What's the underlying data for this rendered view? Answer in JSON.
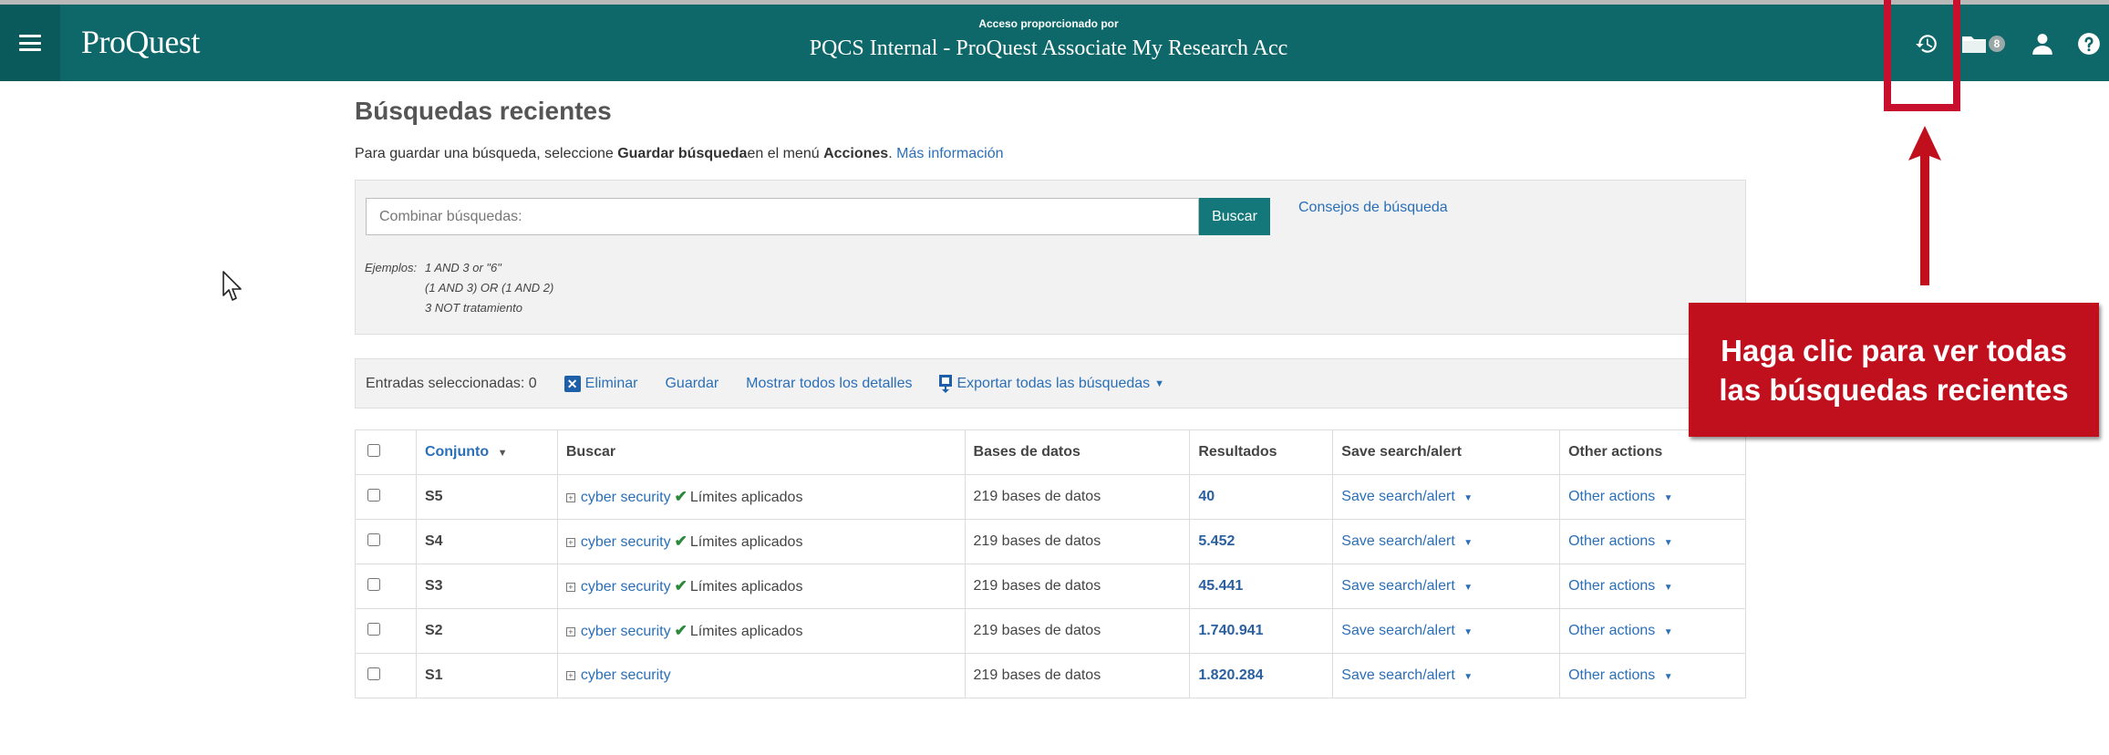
{
  "header": {
    "logo": "ProQuest",
    "access_label": "Acceso proporcionado por",
    "institution": "PQCS Internal - ProQuest Associate My Research Acc",
    "folder_count": "8"
  },
  "page": {
    "title": "Búsquedas recientes",
    "hint_prefix": "Para guardar una búsqueda, seleccione ",
    "hint_bold1": "Guardar búsqueda",
    "hint_middle": "en el menú ",
    "hint_bold2": "Acciones",
    "hint_dot": ".",
    "hint_link": "Más información"
  },
  "search": {
    "placeholder": "Combinar búsquedas:",
    "button": "Buscar",
    "tips_link": "Consejos de búsqueda",
    "examples_label": "Ejemplos:",
    "examples": [
      "1 AND 3 or \"6\"",
      "(1 AND 3) OR (1 AND 2)",
      "3 NOT tratamiento"
    ]
  },
  "actions": {
    "selected": "Entradas seleccionadas: 0",
    "delete": "Eliminar",
    "save": "Guardar",
    "show_details": "Mostrar todos los detalles",
    "export": "Exportar todas las búsquedas"
  },
  "table": {
    "headers": {
      "set": "Conjunto",
      "search": "Buscar",
      "databases": "Bases de datos",
      "results": "Resultados",
      "save": "Save search/alert",
      "other": "Other actions"
    },
    "rows": [
      {
        "set": "S5",
        "query": "cyber security",
        "limits": "Límites aplicados",
        "databases": "219 bases de datos",
        "results": "40",
        "save": "Save search/alert",
        "other": "Other actions"
      },
      {
        "set": "S4",
        "query": "cyber security",
        "limits": "Límites aplicados",
        "databases": "219 bases de datos",
        "results": "5.452",
        "save": "Save search/alert",
        "other": "Other actions"
      },
      {
        "set": "S3",
        "query": "cyber security",
        "limits": "Límites aplicados",
        "databases": "219 bases de datos",
        "results": "45.441",
        "save": "Save search/alert",
        "other": "Other actions"
      },
      {
        "set": "S2",
        "query": "cyber security",
        "limits": "Límites aplicados",
        "databases": "219 bases de datos",
        "results": "1.740.941",
        "save": "Save search/alert",
        "other": "Other actions"
      },
      {
        "set": "S1",
        "query": "cyber security",
        "limits": "",
        "databases": "219 bases de datos",
        "results": "1.820.284",
        "save": "Save search/alert",
        "other": "Other actions"
      }
    ]
  },
  "callout": {
    "line1": "Haga clic para ver todas",
    "line2": "las búsquedas recientes"
  },
  "colors": {
    "header_bg": "#0e6769",
    "accent_button": "#14787a",
    "link": "#2a6fb8",
    "callout_red": "#c0101e"
  },
  "icons": [
    "menu-icon",
    "history-icon",
    "folder-icon",
    "user-icon",
    "help-icon",
    "delete-x-icon",
    "export-icon",
    "expand-icon",
    "checkmark-icon"
  ]
}
